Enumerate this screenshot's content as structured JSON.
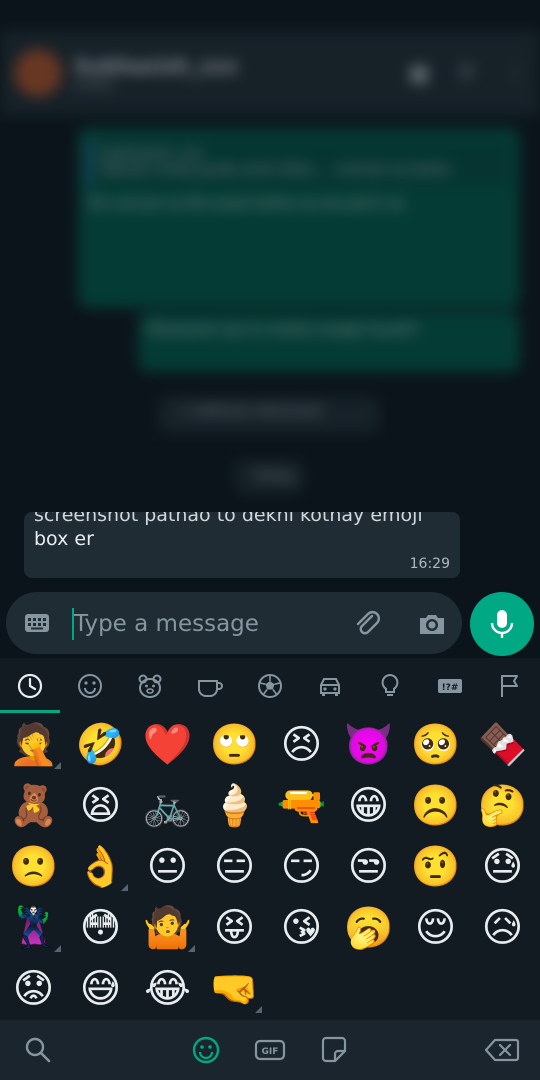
{
  "chat": {
    "contact_name": "Subhasish_xxx",
    "contact_status": "online",
    "quoted_author": "Subhasish_xxx",
    "quoted_text": "Tabular emoji guide ache likha ... normal na kotha",
    "sent_1": "Ok normal na file asset kotha na ota pitch na",
    "sent_2": "Ekhanerer kp tt e kotha rangeli lavalli?",
    "unread_pill": "1 UNREAD MESSAGE",
    "date_pill": "Today",
    "received_partial": "screenshot pathao to dekhi kothay emoji",
    "received_text": "box er",
    "received_time": "16:29"
  },
  "composer": {
    "placeholder": "Type a message"
  },
  "emoji_categories": [
    "recent-icon",
    "smileys-icon",
    "animals-icon",
    "food-icon",
    "activity-icon",
    "travel-icon",
    "objects-icon",
    "symbols-icon",
    "flags-icon"
  ],
  "emoji_rows": [
    [
      "🤦",
      "🤣",
      "❤️",
      "🙄",
      "😣",
      "👿",
      "🥺",
      "🍫"
    ],
    [
      "🧸",
      "😫",
      "🚲",
      "🍦",
      "🔫",
      "😁",
      "☹️",
      "🤔"
    ],
    [
      "🙁",
      "👌",
      "😐",
      "😑",
      "😏",
      "😒",
      "🤨",
      "😓"
    ],
    [
      "🦹",
      "😳",
      "🤷",
      "😝",
      "😘",
      "🥱",
      "😌",
      "😥"
    ],
    [
      "😟",
      "😅",
      "😂",
      "🤜"
    ]
  ],
  "emoji_variant_flags": [
    [
      true,
      false,
      false,
      false,
      false,
      false,
      false,
      false
    ],
    [
      false,
      false,
      false,
      false,
      false,
      false,
      false,
      false
    ],
    [
      false,
      true,
      false,
      false,
      false,
      false,
      false,
      false
    ],
    [
      true,
      false,
      true,
      false,
      false,
      false,
      false,
      false
    ],
    [
      false,
      false,
      false,
      true
    ]
  ],
  "colors": {
    "accent": "#00a884",
    "panel_bg": "#121b22",
    "bubble_bg": "#1f2c34"
  }
}
